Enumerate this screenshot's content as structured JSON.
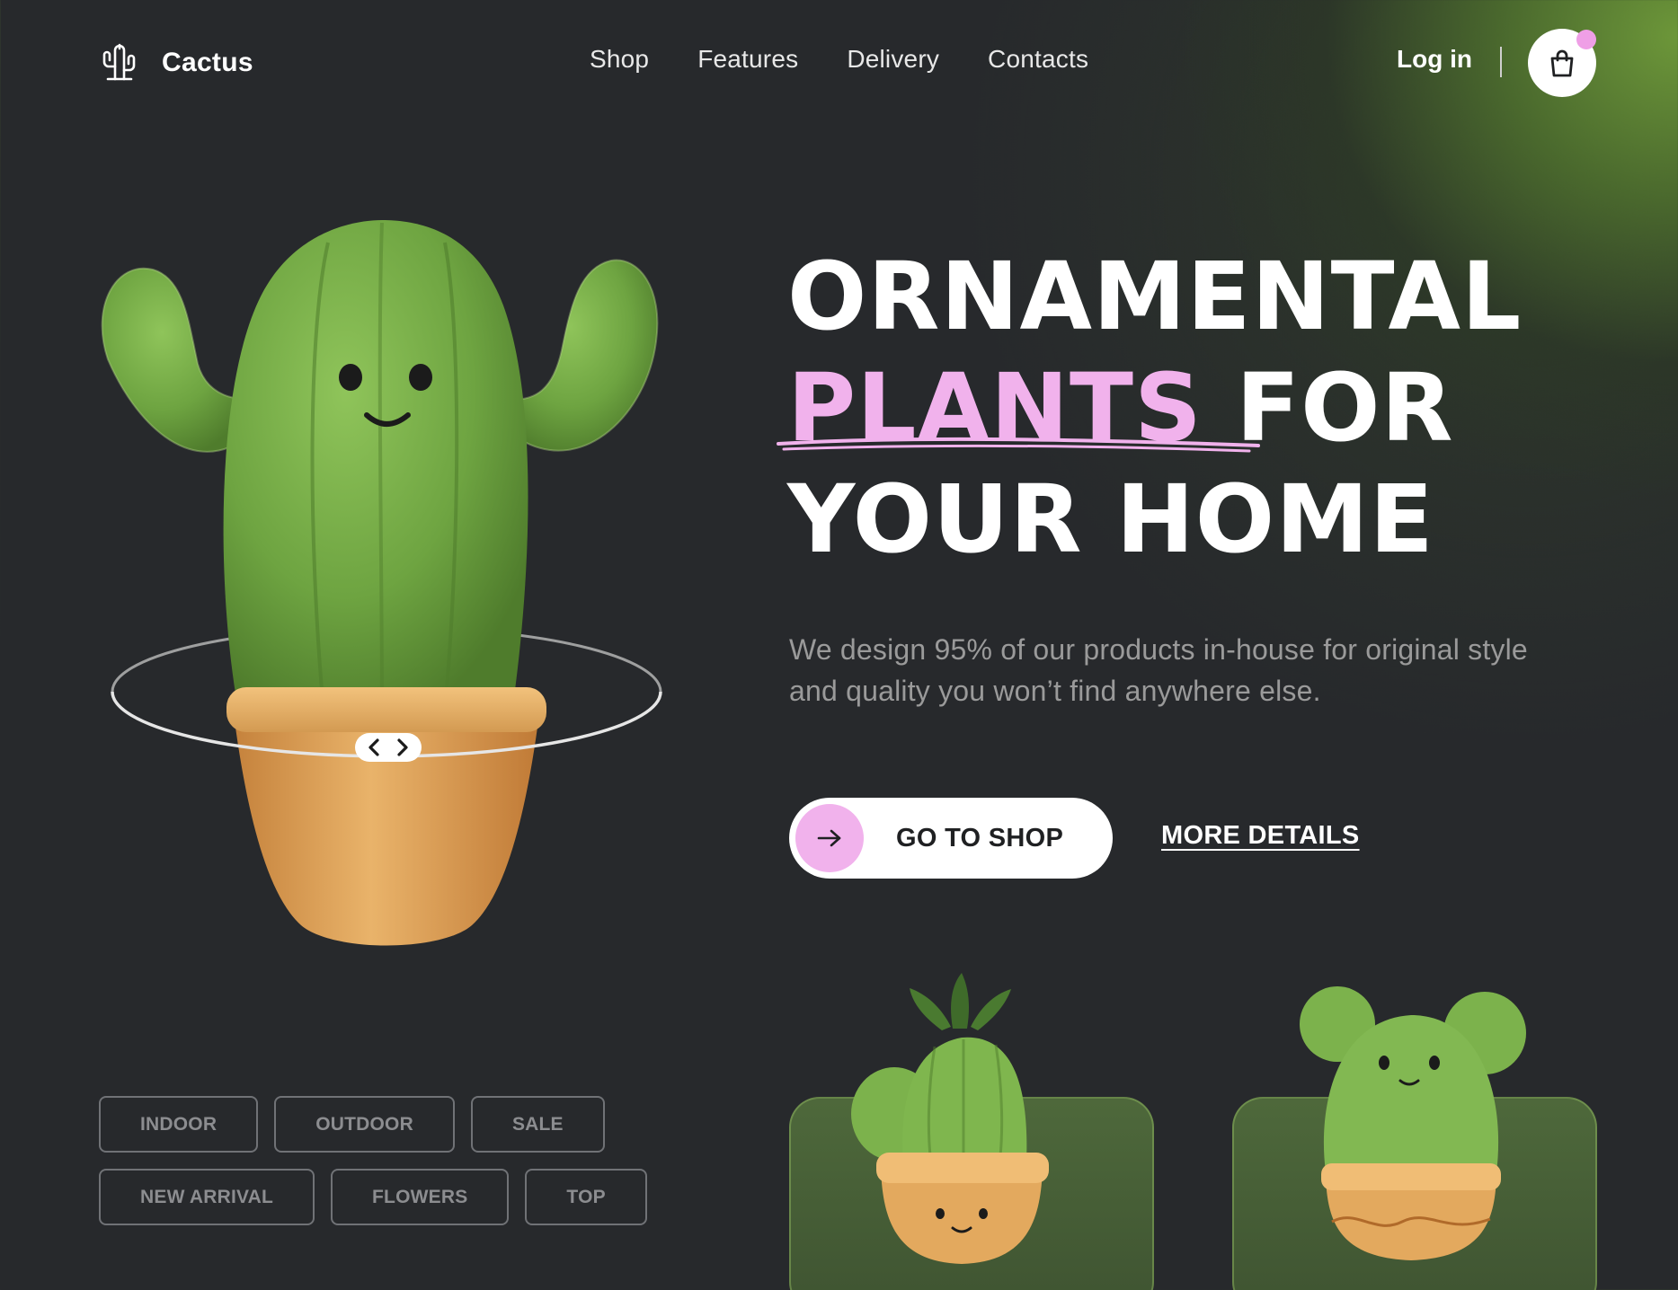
{
  "brand": {
    "name": "Cactus",
    "logo_icon": "cactus-icon"
  },
  "nav": {
    "items": [
      "Shop",
      "Features",
      "Delivery",
      "Contacts"
    ]
  },
  "header": {
    "login_label": "Log in",
    "cart_icon": "shopping-bag-icon"
  },
  "hero": {
    "title_line1": "ORNAMENTAL",
    "title_highlight": "PLANTS",
    "title_line2_rest": "FOR",
    "title_line3": "YOUR HOME",
    "subtitle": "We design 95% of our products in-house for original style and quality you won’t find anywhere else.",
    "primary_cta": "GO TO SHOP",
    "secondary_cta": "MORE DETAILS"
  },
  "tags": {
    "row1": [
      "INDOOR",
      "OUTDOOR",
      "SALE"
    ],
    "row2": [
      "NEW ARRIVAL",
      "FLOWERS",
      "TOP"
    ]
  },
  "colors": {
    "background": "#27292c",
    "accent_pink": "#f1b2ec",
    "accent_green": "#6f9a3e",
    "pot_orange": "#d9a25a"
  }
}
